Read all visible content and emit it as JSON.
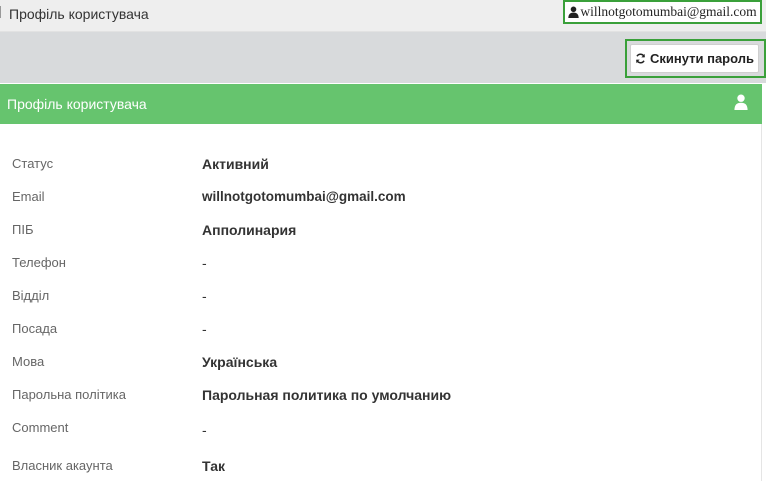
{
  "topbar": {
    "title": "Профіль користувача",
    "user_email": "willnotgotomumbai@gmail.com"
  },
  "toolbar": {
    "reset_password_label": "Скинути пароль"
  },
  "panel": {
    "title": "Профіль користувача",
    "header_color": "#66c46e"
  },
  "fields": [
    {
      "label": "Статус",
      "value": "Активний"
    },
    {
      "label": "Email",
      "value": "willnotgotomumbai@gmail.com"
    },
    {
      "label": "ПІБ",
      "value": "Апполинария"
    },
    {
      "label": "Телефон",
      "value": "-"
    },
    {
      "label": "Відділ",
      "value": "-"
    },
    {
      "label": "Посада",
      "value": "-"
    },
    {
      "label": "Мова",
      "value": "Українська"
    },
    {
      "label": "Парольна політика",
      "value": "Парольная политика по умолчанию"
    },
    {
      "label": "Comment",
      "value": "-"
    },
    {
      "label": "Власник акаунта",
      "value": "Так"
    }
  ],
  "icons": {
    "user": "user-icon",
    "refresh": "refresh-icon"
  }
}
